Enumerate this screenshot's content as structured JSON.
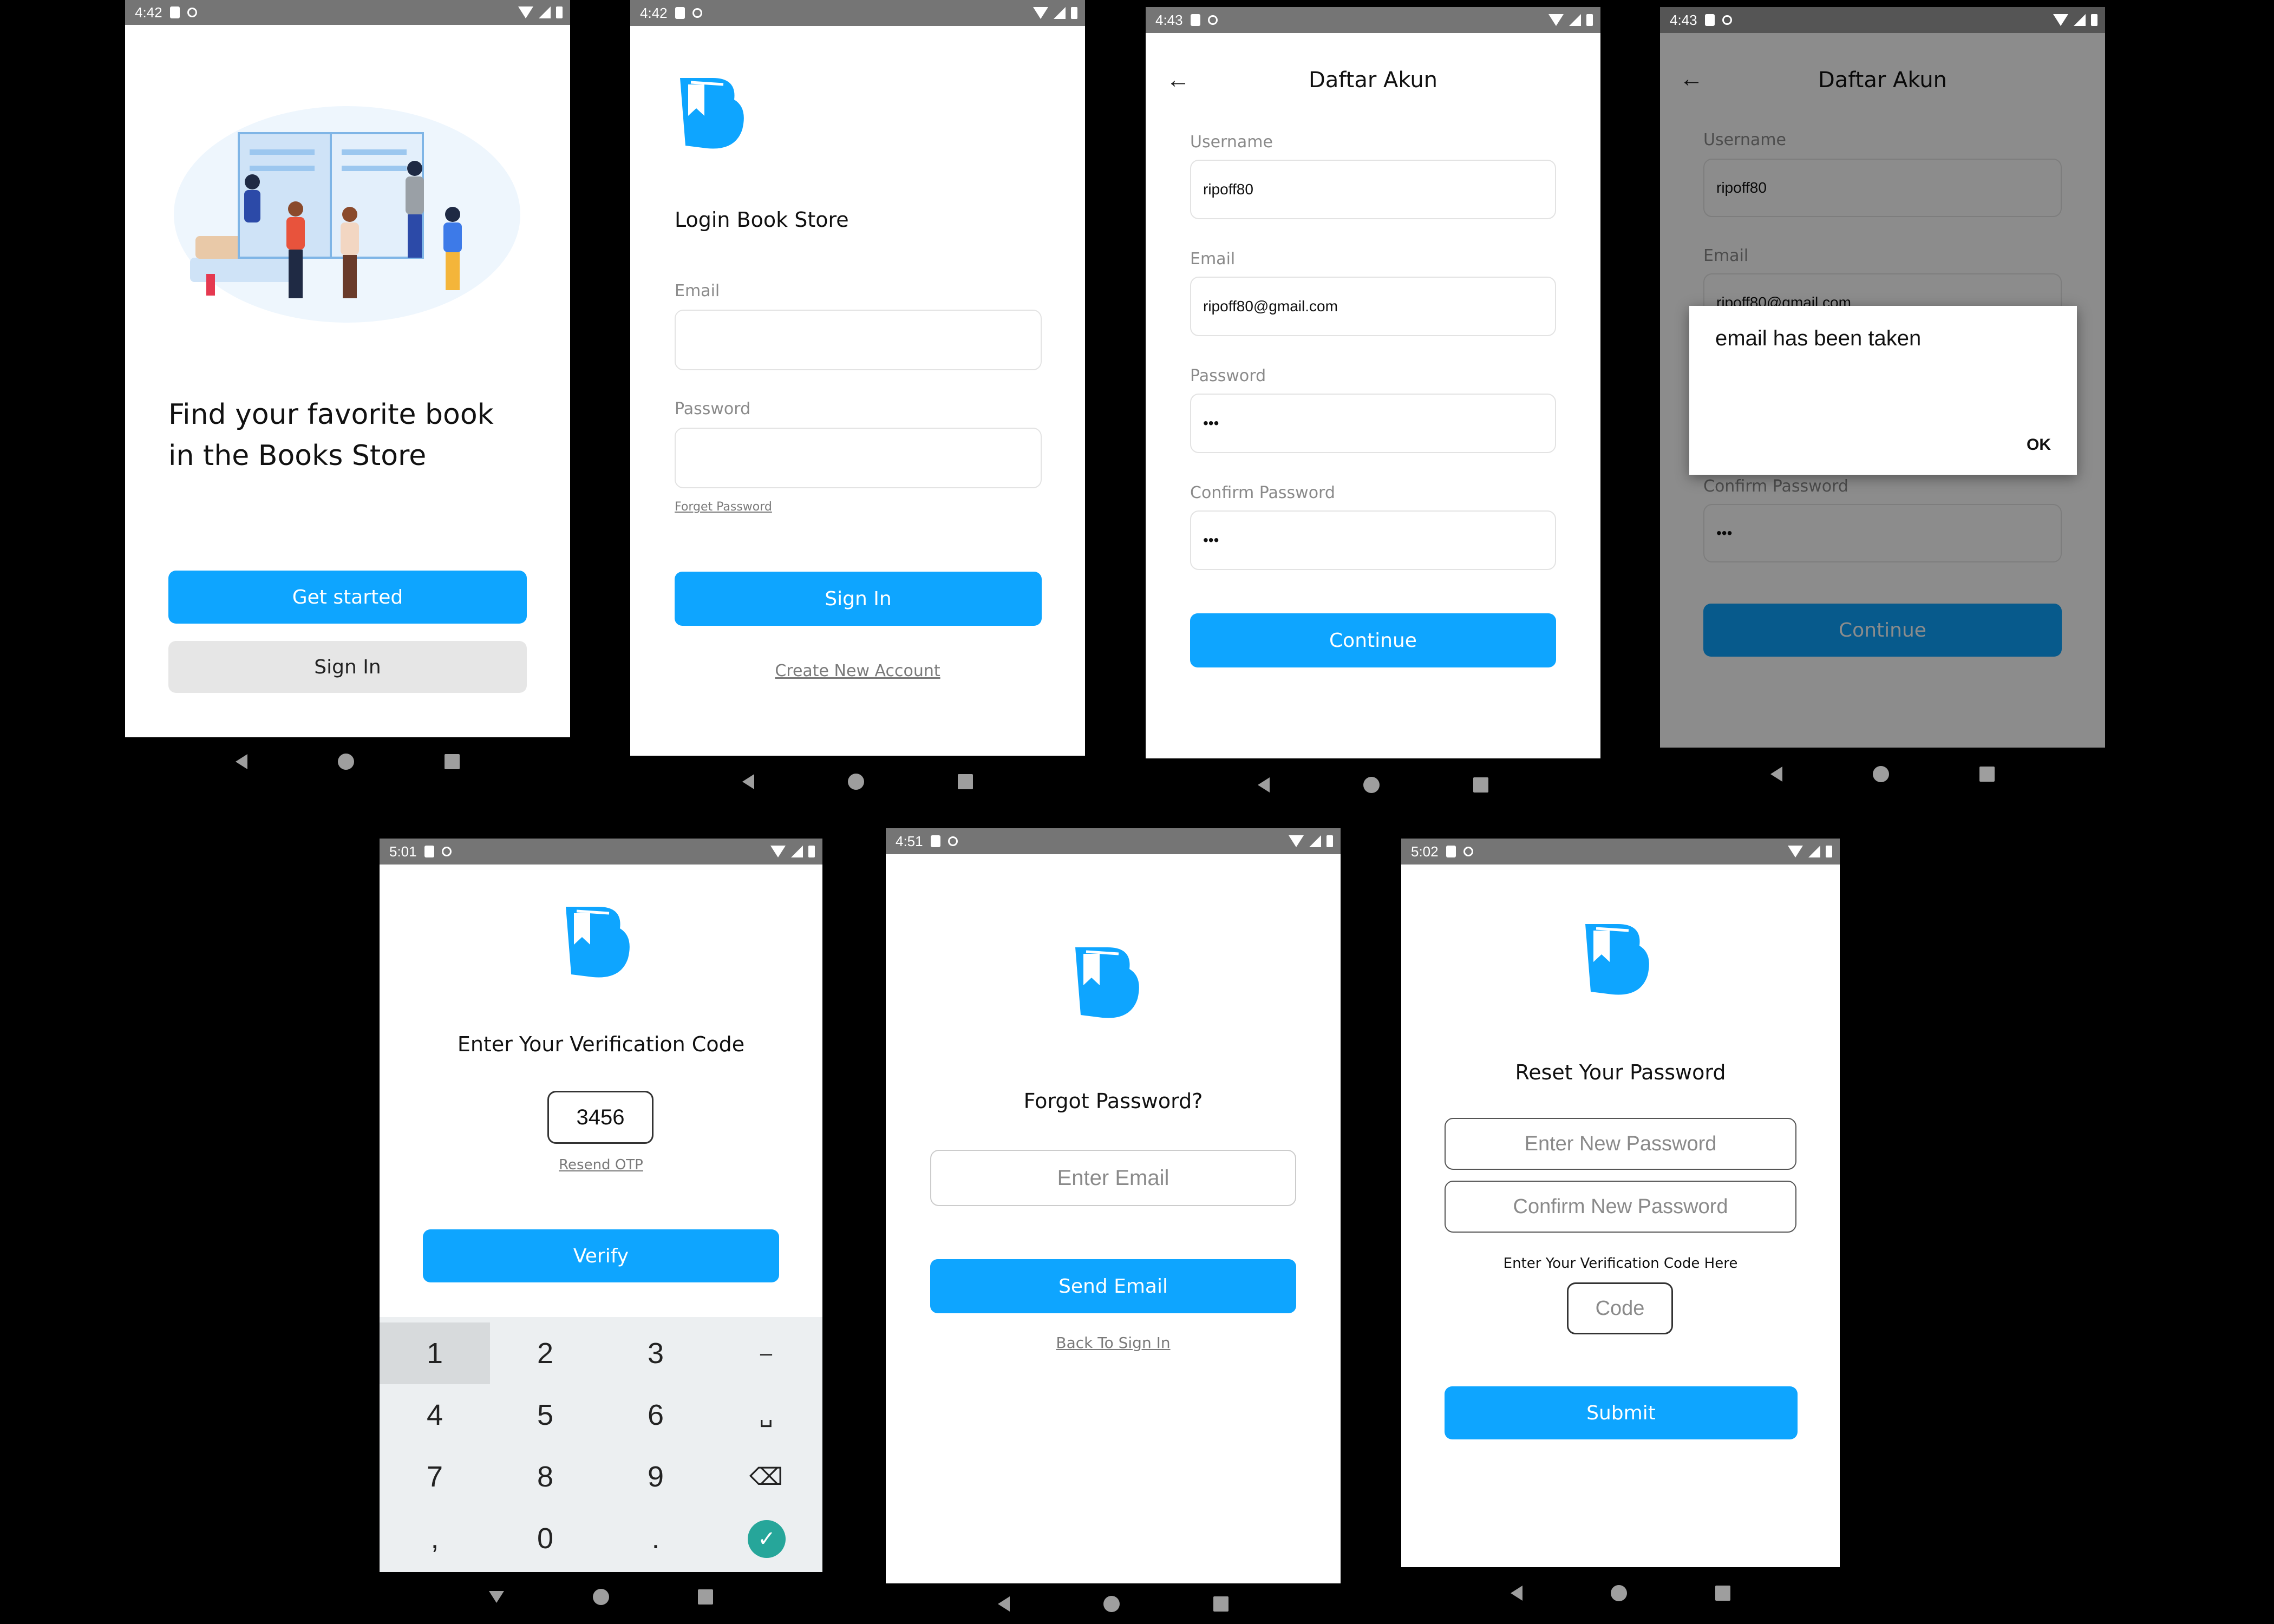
{
  "colors": {
    "accent": "#0ea5ff",
    "statusbar": "#757575",
    "overlay": "rgba(0,0,0,0.45)"
  },
  "s1": {
    "time": "4:42",
    "headline1": "Find your favorite book",
    "headline2": "in the Books Store",
    "get_started": "Get started",
    "sign_in": "Sign In"
  },
  "s2": {
    "time": "4:42",
    "title": "Login Book Store",
    "email_label": "Email",
    "password_label": "Password",
    "forget": "Forget Password",
    "sign_in": "Sign In",
    "create": "Create New Account"
  },
  "s3": {
    "time": "4:43",
    "title": "Daftar Akun",
    "username_label": "Username",
    "username_value": "ripoff80",
    "email_label": "Email",
    "email_value": "ripoff80@gmail.com",
    "password_label": "Password",
    "password_value": "•••",
    "confirm_label": "Confirm Password",
    "confirm_value": "•••",
    "continue": "Continue"
  },
  "s4": {
    "time": "4:43",
    "title": "Daftar Akun",
    "username_label": "Username",
    "username_value": "ripoff80",
    "email_label": "Email",
    "email_value": "ripoff80@gmail.com",
    "confirm_label": "Confirm Password",
    "confirm_value": "•••",
    "continue": "Continue",
    "dialog_msg": "email has been taken",
    "dialog_ok": "OK"
  },
  "s5": {
    "time": "5:01",
    "title": "Enter Your Verification Code",
    "code": "3456",
    "resend": "Resend OTP",
    "verify": "Verify",
    "keys": [
      "1",
      "2",
      "3",
      "–",
      "4",
      "5",
      "6",
      "␣",
      "7",
      "8",
      "9",
      "⌫",
      ",",
      "0",
      ".",
      "✓"
    ]
  },
  "s6": {
    "time": "4:51",
    "title": "Forgot Password?",
    "email_placeholder": "Enter Email",
    "send": "Send Email",
    "back": "Back To Sign In"
  },
  "s7": {
    "time": "5:02",
    "title": "Reset Your Password",
    "new_pw": "Enter New Password",
    "confirm_pw": "Confirm New Password",
    "code_hint": "Enter Your Verification Code Here",
    "code_placeholder": "Code",
    "submit": "Submit"
  }
}
